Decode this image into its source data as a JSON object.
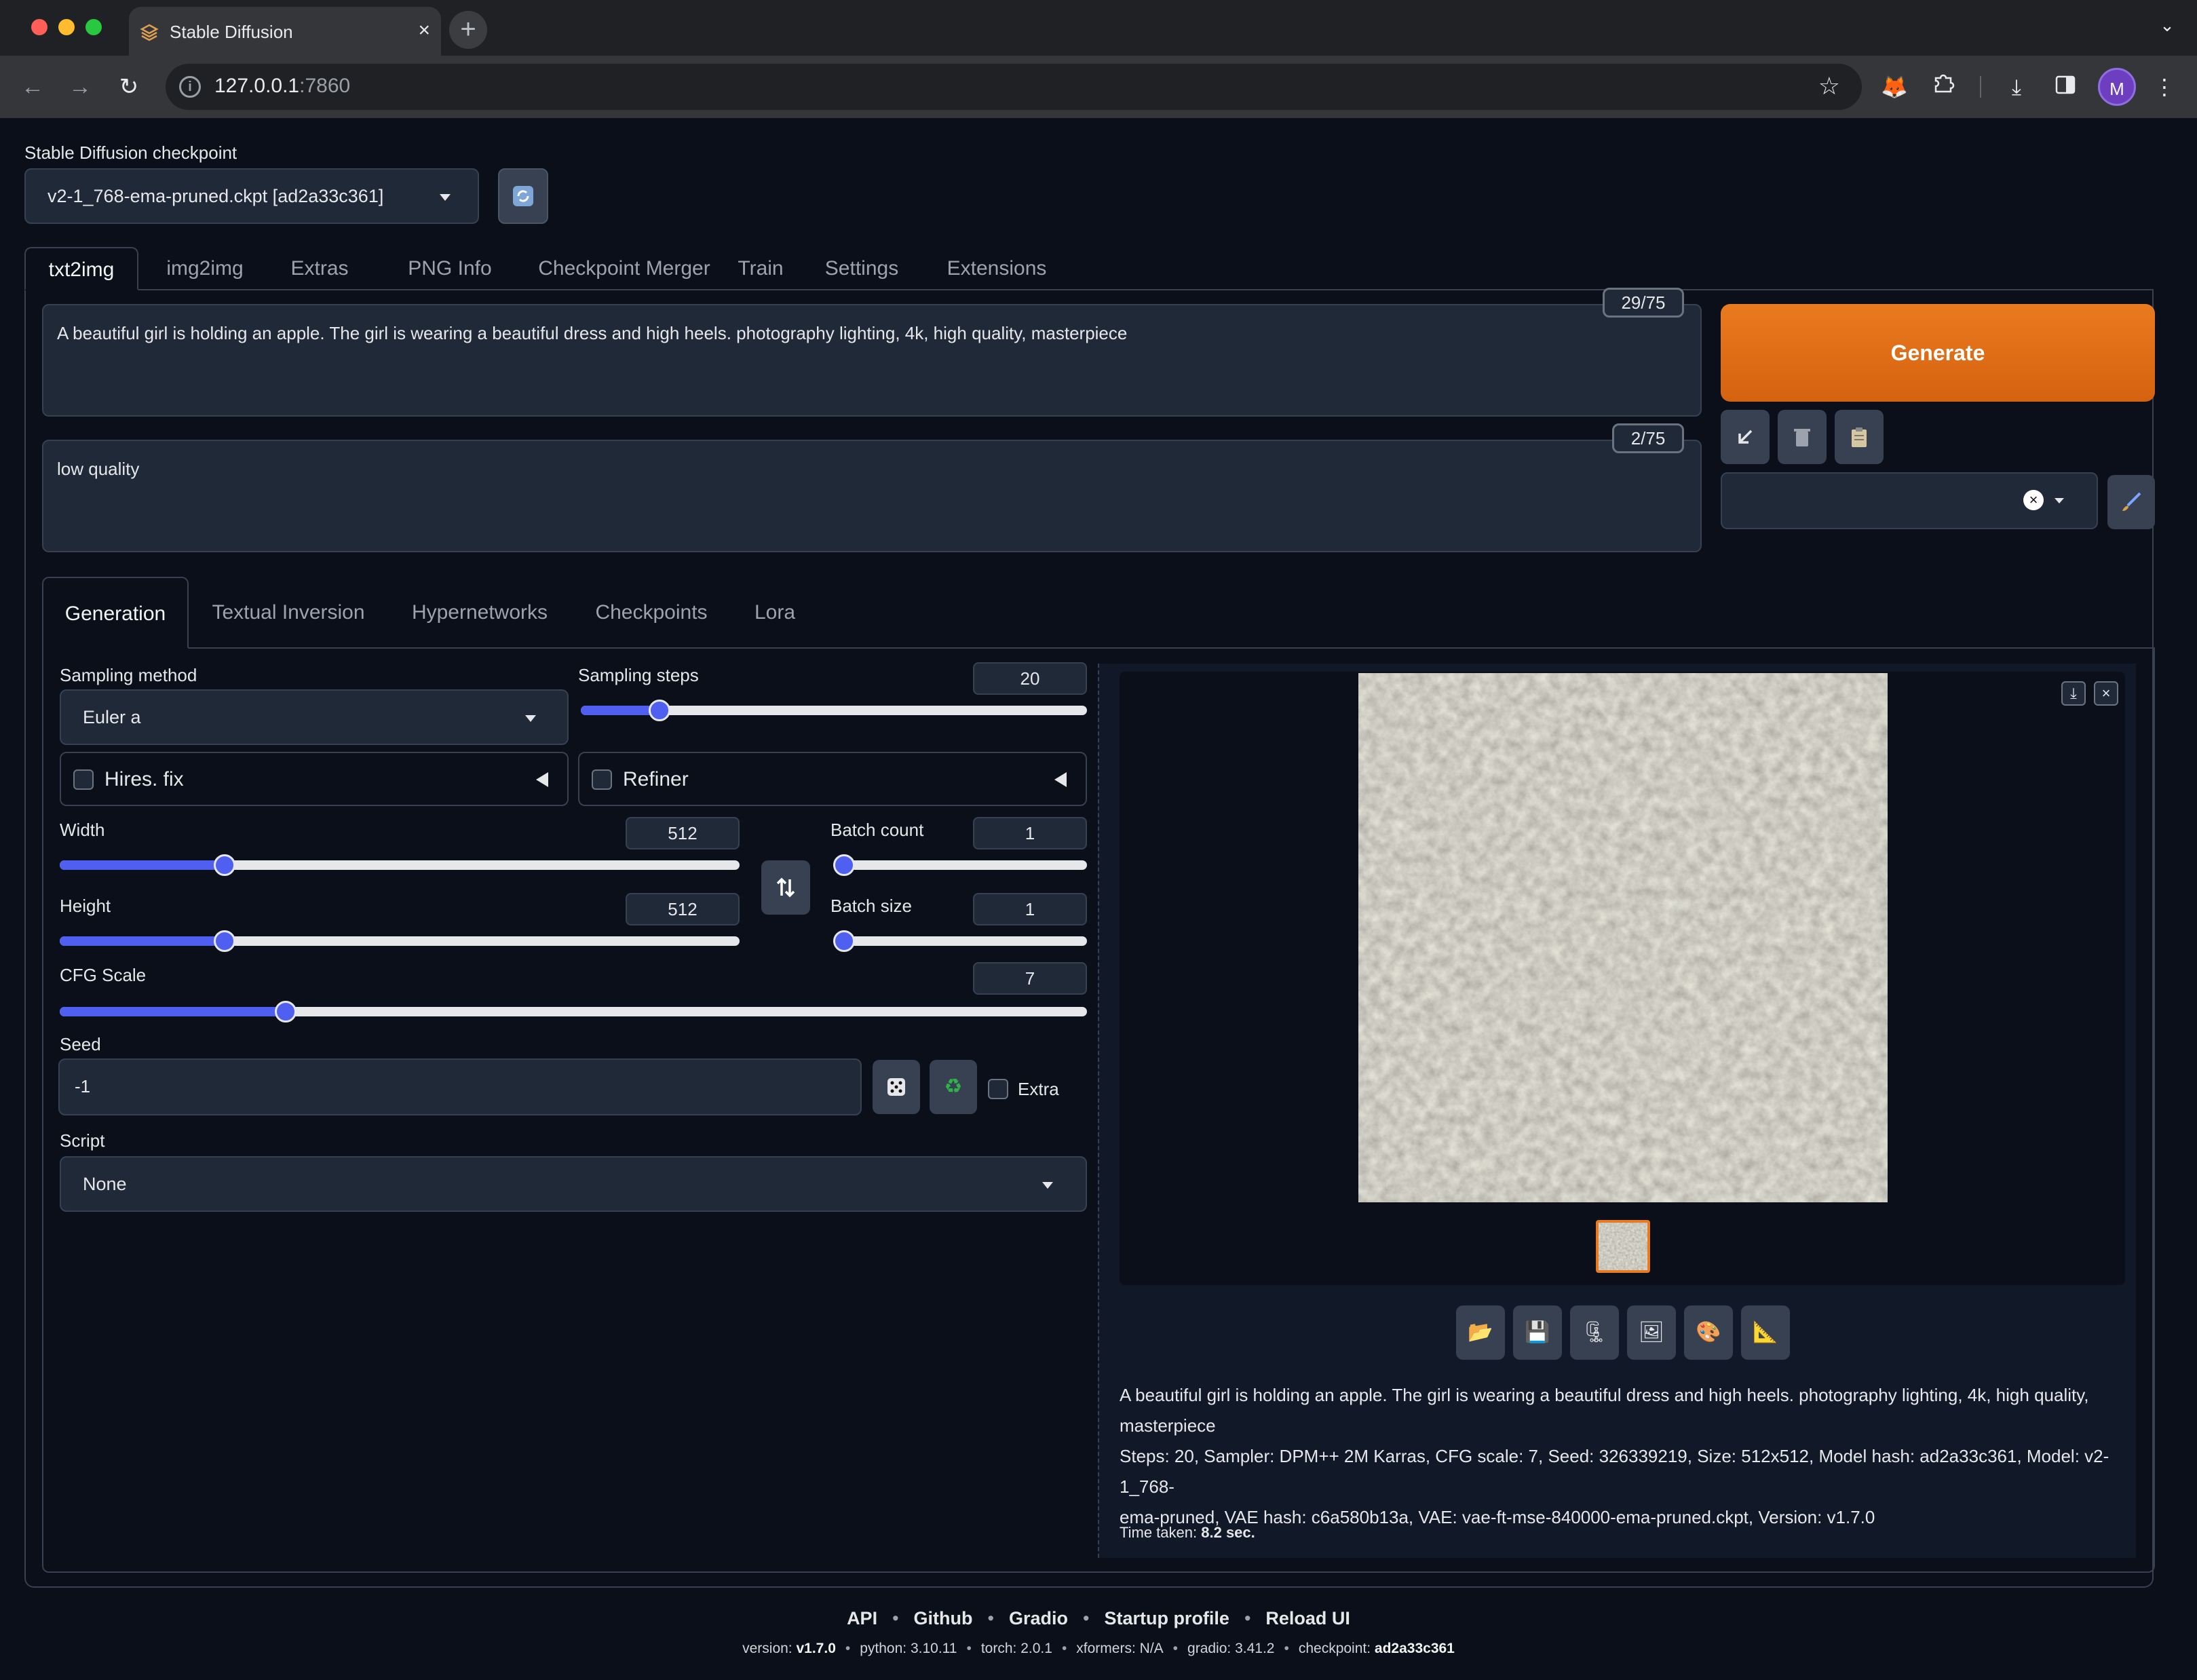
{
  "browser": {
    "tab_title": "Stable Diffusion",
    "url_host": "127.0.0.1",
    "url_port": ":7860",
    "profile_initial": "M"
  },
  "checkpoint": {
    "label": "Stable Diffusion checkpoint",
    "value": "v2-1_768-ema-pruned.ckpt [ad2a33c361]"
  },
  "main_tabs": [
    "txt2img",
    "img2img",
    "Extras",
    "PNG Info",
    "Checkpoint Merger",
    "Train",
    "Settings",
    "Extensions"
  ],
  "prompt": {
    "positive": "A beautiful girl is holding an apple. The girl is wearing a beautiful dress and high heels. photography lighting, 4k, high quality, masterpiece",
    "positive_tokens": "29/75",
    "negative": "low quality",
    "negative_tokens": "2/75"
  },
  "generate_label": "Generate",
  "sub_tabs": [
    "Generation",
    "Textual Inversion",
    "Hypernetworks",
    "Checkpoints",
    "Lora"
  ],
  "params": {
    "sampling_method_label": "Sampling method",
    "sampling_method": "Euler a",
    "sampling_steps_label": "Sampling steps",
    "sampling_steps": "20",
    "hires_fix": "Hires. fix",
    "refiner": "Refiner",
    "width_label": "Width",
    "width": "512",
    "height_label": "Height",
    "height": "512",
    "batch_count_label": "Batch count",
    "batch_count": "1",
    "batch_size_label": "Batch size",
    "batch_size": "1",
    "cfg_label": "CFG Scale",
    "cfg": "7",
    "seed_label": "Seed",
    "seed": "-1",
    "extra_label": "Extra",
    "script_label": "Script",
    "script": "None"
  },
  "sliders": {
    "sampling_steps_fraction": 0.14,
    "width_fraction": 0.234,
    "height_fraction": 0.234,
    "batch_count_fraction": 0.0,
    "batch_size_fraction": 0.0,
    "cfg_fraction": 0.214
  },
  "output": {
    "info_prompt": "A beautiful girl is holding an apple. The girl is wearing a beautiful dress and high heels. photography lighting, 4k, high quality, masterpiece",
    "info_params_1": "Steps: 20, Sampler: DPM++ 2M Karras, CFG scale: 7, Seed: 326339219, Size: 512x512, Model hash: ad2a33c361, Model: v2-1_768-",
    "info_params_2": "ema-pruned, VAE hash: c6a580b13a, VAE: vae-ft-mse-840000-ema-pruned.ckpt, Version: v1.7.0",
    "time_taken_label": "Time taken:",
    "time_taken_value": "8.2 sec."
  },
  "footer": {
    "links": [
      "API",
      "Github",
      "Gradio",
      "Startup profile",
      "Reload UI"
    ],
    "version_label": "version:",
    "version": "v1.7.0",
    "python_label": "python:",
    "python": "3.10.11",
    "torch_label": "torch:",
    "torch": "2.0.1",
    "xformers_label": "xformers:",
    "xformers": "N/A",
    "gradio_label": "gradio:",
    "gradio": "3.41.2",
    "checkpoint_label": "checkpoint:",
    "checkpoint": "ad2a33c361"
  },
  "colors": {
    "accent": "#ea7a1f",
    "slider": "#4f5ff0",
    "background": "#0b0f19",
    "panel": "#1f2937"
  },
  "icons": [
    "refresh-icon",
    "arrow-down-left-icon",
    "trash-icon",
    "clipboard-icon",
    "paintbrush-icon",
    "swap-icon",
    "dice-icon",
    "recycle-icon",
    "folder-icon",
    "save-icon",
    "zip-icon",
    "image-icon",
    "palette-icon",
    "ruler-icon"
  ]
}
